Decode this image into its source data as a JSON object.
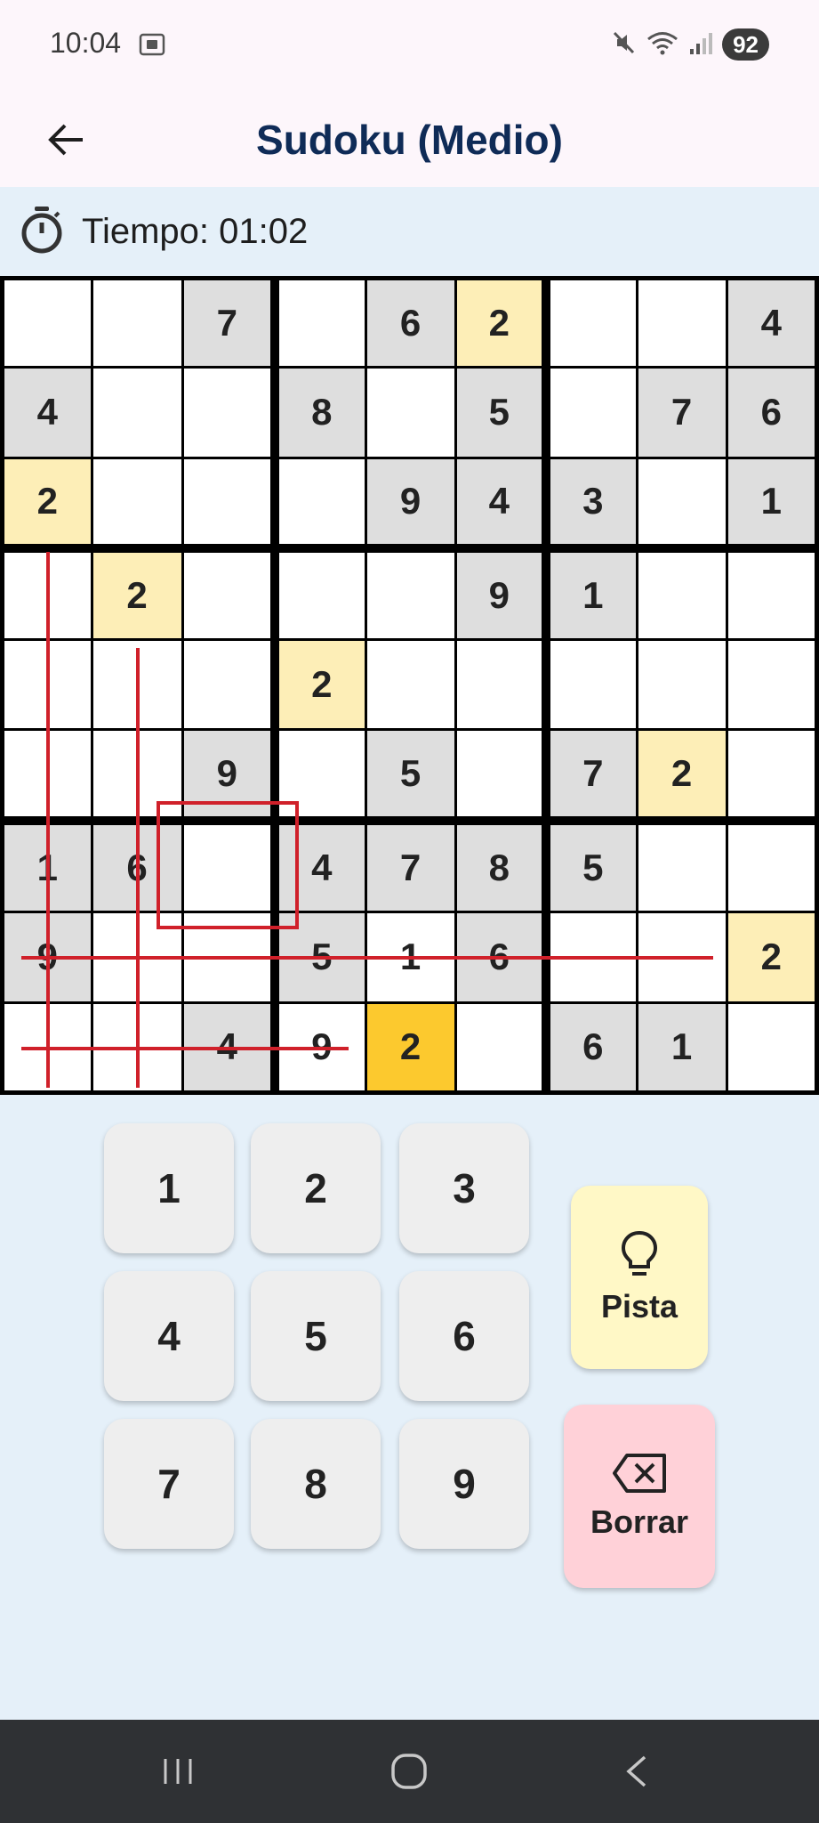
{
  "status_bar": {
    "time": "10:04",
    "battery": "92"
  },
  "app_bar": {
    "title": "Sudoku (Medio)"
  },
  "timer": {
    "text": "Tiempo: 01:02"
  },
  "board": {
    "rows": [
      [
        "",
        "",
        "7",
        "",
        "6",
        "2",
        "",
        "",
        "4"
      ],
      [
        "4",
        "",
        "",
        "8",
        "",
        "5",
        "",
        "7",
        "6"
      ],
      [
        "2",
        "",
        "",
        "",
        "9",
        "4",
        "3",
        "",
        "1"
      ],
      [
        "",
        "2",
        "",
        "",
        "",
        "9",
        "1",
        "",
        ""
      ],
      [
        "",
        "",
        "",
        "2",
        "",
        "",
        "",
        "",
        ""
      ],
      [
        "",
        "",
        "9",
        "",
        "5",
        "",
        "7",
        "2",
        ""
      ],
      [
        "1",
        "6",
        "",
        "4",
        "7",
        "8",
        "5",
        "",
        ""
      ],
      [
        "9",
        "",
        "",
        "5",
        "1",
        "6",
        "",
        "",
        "2"
      ],
      [
        "",
        "",
        "4",
        "9",
        "2",
        "",
        "6",
        "1",
        ""
      ]
    ],
    "cell_types": [
      [
        "e",
        "e",
        "g",
        "e",
        "g",
        "h",
        "e",
        "e",
        "g"
      ],
      [
        "g",
        "e",
        "e",
        "g",
        "e",
        "g",
        "e",
        "g",
        "g"
      ],
      [
        "h",
        "e",
        "e",
        "e",
        "g",
        "g",
        "g",
        "e",
        "g"
      ],
      [
        "e",
        "h",
        "e",
        "e",
        "e",
        "g",
        "g",
        "e",
        "e"
      ],
      [
        "e",
        "e",
        "e",
        "h",
        "e",
        "e",
        "e",
        "e",
        "e"
      ],
      [
        "e",
        "e",
        "g",
        "e",
        "g",
        "e",
        "g",
        "h",
        "e"
      ],
      [
        "g",
        "g",
        "e",
        "g",
        "g",
        "g",
        "g",
        "e",
        "e"
      ],
      [
        "g",
        "e",
        "e",
        "g",
        "e",
        "g",
        "e",
        "e",
        "h"
      ],
      [
        "e",
        "e",
        "g",
        "e",
        "s",
        "e",
        "g",
        "g",
        "e"
      ]
    ]
  },
  "keypad": {
    "keys": [
      "1",
      "2",
      "3",
      "4",
      "5",
      "6",
      "7",
      "8",
      "9"
    ]
  },
  "actions": {
    "hint_label": "Pista",
    "erase_label": "Borrar"
  },
  "colors": {
    "given_cell": "#dedede",
    "highlight_cell": "#fdeeb7",
    "selected_cell": "#fcc92e",
    "annotation_red": "#d0202a",
    "title": "#0f2b57"
  }
}
